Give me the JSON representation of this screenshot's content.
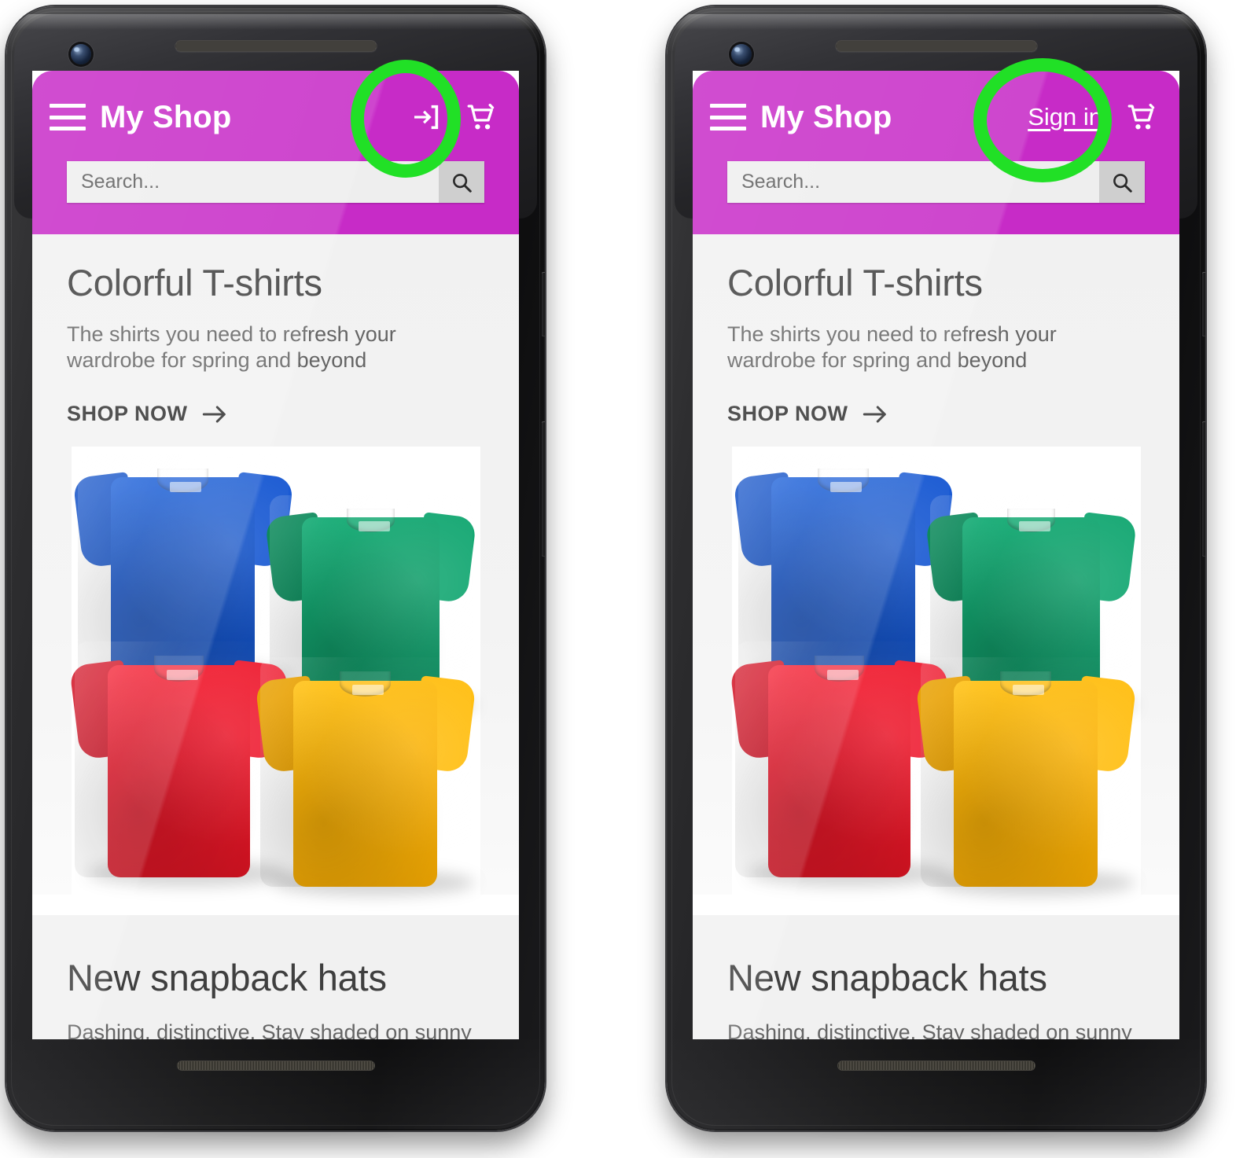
{
  "meta": {
    "annotation_color": "#21e026",
    "brand_color": "#c72bc7"
  },
  "phones": [
    {
      "id": "phone-left",
      "variant": "icon",
      "appbar": {
        "menu_icon": "hamburger-menu-icon",
        "title": "My Shop",
        "signin_icon": "login-arrow-icon",
        "signin_label": "",
        "cart_icon": "shopping-cart-icon"
      },
      "search": {
        "placeholder": "Search...",
        "value": "",
        "button_icon": "search-icon"
      },
      "cards": [
        {
          "heading": "Colorful T-shirts",
          "body": "The shirts you need to refresh your wardrobe for spring and beyond",
          "cta": "SHOP NOW",
          "cta_icon": "arrow-right-icon",
          "image": {
            "alt": "four folded t-shirts",
            "shirts": [
              {
                "name": "blue-tshirt",
                "color": "#1453c8"
              },
              {
                "name": "green-tshirt",
                "color": "#13a06c"
              },
              {
                "name": "red-tshirt",
                "color": "#ec1b2e"
              },
              {
                "name": "yellow-tshirt",
                "color": "#fbb40a"
              }
            ]
          }
        },
        {
          "heading": "New snapback hats",
          "body": "Dashing, distinctive. Stay shaded on sunny",
          "cta": "",
          "cta_icon": ""
        }
      ]
    },
    {
      "id": "phone-right",
      "variant": "text",
      "appbar": {
        "menu_icon": "hamburger-menu-icon",
        "title": "My Shop",
        "signin_icon": "",
        "signin_label": "Sign in",
        "cart_icon": "shopping-cart-icon"
      },
      "search": {
        "placeholder": "Search...",
        "value": "",
        "button_icon": "search-icon"
      },
      "cards": [
        {
          "heading": "Colorful T-shirts",
          "body": "The shirts you need to refresh your wardrobe for spring and beyond",
          "cta": "SHOP NOW",
          "cta_icon": "arrow-right-icon",
          "image": {
            "alt": "four folded t-shirts",
            "shirts": [
              {
                "name": "blue-tshirt",
                "color": "#1453c8"
              },
              {
                "name": "green-tshirt",
                "color": "#13a06c"
              },
              {
                "name": "red-tshirt",
                "color": "#ec1b2e"
              },
              {
                "name": "yellow-tshirt",
                "color": "#fbb40a"
              }
            ]
          }
        },
        {
          "heading": "New snapback hats",
          "body": "Dashing, distinctive. Stay shaded on sunny",
          "cta": "",
          "cta_icon": ""
        }
      ]
    }
  ]
}
